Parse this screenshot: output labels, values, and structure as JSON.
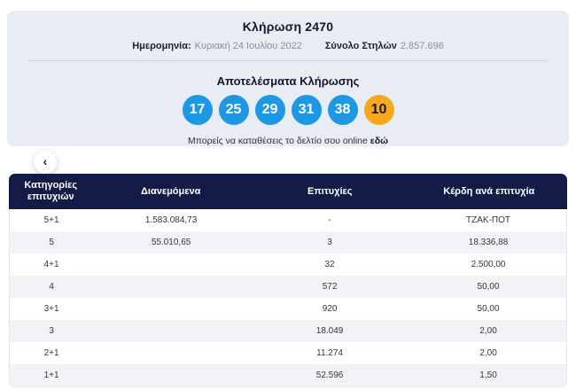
{
  "colors": {
    "panel_bg": "#e8ecf3",
    "table_header_navy": "#121c47",
    "number_ball_blue": "#1e97e4",
    "bonus_ball_yellow": "#f7a81c",
    "alt_row_gray": "#f2f3f7"
  },
  "draw": {
    "title": "Κλήρωση 2470",
    "date_label": "Ημερομηνία:",
    "date_value": "Κυριακή 24 Ιουλίου 2022",
    "columns_label": "Σύνολο Στηλών",
    "columns_value": "2.857.696",
    "results_heading": "Αποτελέσματα Κλήρωσης",
    "numbers": [
      "17",
      "25",
      "29",
      "31",
      "38"
    ],
    "bonus_number": "10",
    "online_text": "Μπορείς να καταθέσεις το δελτίο σου online",
    "online_link_label": "εδώ"
  },
  "icons": {
    "chevron_left": "‹"
  },
  "results_table": {
    "headers": {
      "category": "Κατηγορίες\nεπιτυχιών",
      "distributed": "Διανεμόμενα",
      "winners": "Επιτυχίες",
      "payout": "Κέρδη ανά επιτυχία"
    },
    "rows": [
      {
        "category": "5+1",
        "distributed": "1.583.084,73",
        "winners": "-",
        "payout": "ΤΖΑΚ-ΠΟΤ"
      },
      {
        "category": "5",
        "distributed": "55.010,65",
        "winners": "3",
        "payout": "18.336,88"
      },
      {
        "category": "4+1",
        "distributed": "",
        "winners": "32",
        "payout": "2.500,00"
      },
      {
        "category": "4",
        "distributed": "",
        "winners": "572",
        "payout": "50,00"
      },
      {
        "category": "3+1",
        "distributed": "",
        "winners": "920",
        "payout": "50,00"
      },
      {
        "category": "3",
        "distributed": "",
        "winners": "18.049",
        "payout": "2,00"
      },
      {
        "category": "2+1",
        "distributed": "",
        "winners": "11.274",
        "payout": "2,00"
      },
      {
        "category": "1+1",
        "distributed": "",
        "winners": "52.596",
        "payout": "1,50"
      }
    ]
  }
}
